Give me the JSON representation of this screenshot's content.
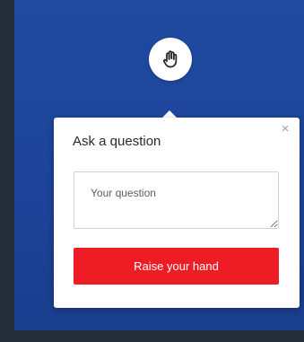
{
  "raise_hand_icon": "raised-hand-icon",
  "popover": {
    "title": "Ask a question",
    "close_label": "×",
    "question_input": {
      "value": "",
      "placeholder": "Your question"
    },
    "submit_label": "Raise your hand"
  },
  "colors": {
    "background": "#1f4aa0",
    "accent_button": "#ee1c25"
  }
}
